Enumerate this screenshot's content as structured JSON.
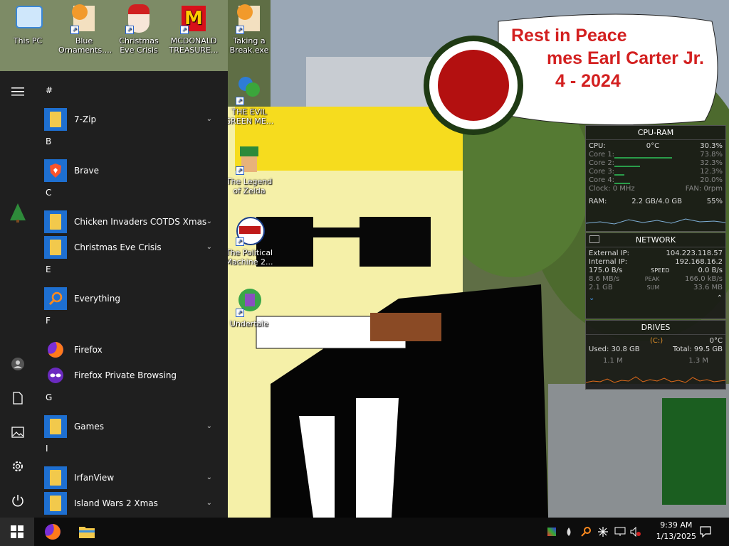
{
  "desktop_icons": [
    {
      "label": "This PC",
      "icon": "computer-icon"
    },
    {
      "label": "Blue Ornaments....",
      "icon": "ornament-app-icon"
    },
    {
      "label": "Christmas Eve Crisis",
      "icon": "santa-app-icon"
    },
    {
      "label": "MCDONALD TREASURE...",
      "icon": "mcdonalds-app-icon"
    },
    {
      "label": "Taking a Break.exe",
      "icon": "break-app-icon"
    },
    {
      "label": "THE EVIL GREEN ME...",
      "icon": "messenger-app-icon"
    },
    {
      "label": "The Legend of Zelda",
      "icon": "zelda-app-icon"
    },
    {
      "label": "The Political Machine 2...",
      "icon": "political-app-icon"
    },
    {
      "label": "Undertale",
      "icon": "undertale-app-icon"
    }
  ],
  "memorial": {
    "line1": "Rest in Peace",
    "line2": "mes Earl Carter Jr.",
    "line3": "4 - 2024"
  },
  "start_menu": {
    "groups": [
      {
        "letter": "#",
        "apps": [
          {
            "name": "7-Zip",
            "folder": true
          }
        ]
      },
      {
        "letter": "B",
        "apps": [
          {
            "name": "Brave",
            "folder": false,
            "icon": "brave-icon"
          }
        ]
      },
      {
        "letter": "C",
        "apps": [
          {
            "name": "Chicken Invaders COTDS Xmas",
            "folder": true
          },
          {
            "name": "Christmas Eve Crisis",
            "folder": true
          }
        ]
      },
      {
        "letter": "E",
        "apps": [
          {
            "name": "Everything",
            "folder": false,
            "icon": "everything-search-icon"
          }
        ]
      },
      {
        "letter": "F",
        "apps": [
          {
            "name": "Firefox",
            "folder": false,
            "icon": "firefox-icon"
          },
          {
            "name": "Firefox Private Browsing",
            "folder": false,
            "icon": "firefox-private-icon"
          }
        ]
      },
      {
        "letter": "G",
        "apps": [
          {
            "name": "Games",
            "folder": true
          }
        ]
      },
      {
        "letter": "I",
        "apps": [
          {
            "name": "IrfanView",
            "folder": true
          },
          {
            "name": "Island Wars 2 Xmas",
            "folder": true
          }
        ]
      }
    ]
  },
  "cpu_ram": {
    "title": "CPU-RAM",
    "cpu_label": "CPU:",
    "cpu_temp": "0°C",
    "cpu_pct": "30.3%",
    "cores": [
      {
        "label": "Core 1:",
        "pct": "73.8%",
        "frac": 0.738
      },
      {
        "label": "Core 2:",
        "pct": "32.3%",
        "frac": 0.323
      },
      {
        "label": "Core 3:",
        "pct": "12.3%",
        "frac": 0.123
      },
      {
        "label": "Core 4:",
        "pct": "20.0%",
        "frac": 0.2
      }
    ],
    "clock": "Clock: 0 MHz",
    "fan": "FAN: 0rpm",
    "ram_label": "RAM:",
    "ram_val": "2.2 GB/4.0 GB",
    "ram_pct": "55%"
  },
  "network": {
    "title": "NETWORK",
    "ext_label": "External IP:",
    "ext_ip": "104.223.118.57",
    "int_label": "Internal IP:",
    "int_ip": "192.168.16.2",
    "speed_up": "175.0 B/s",
    "speed_label": "SPEED",
    "speed_down": "0.0 B/s",
    "peak_up": "8.6 MB/s",
    "peak_label": "PEAK",
    "peak_down": "166.0 kB/s",
    "sum_up": "2.1 GB",
    "sum_label": "SUM",
    "sum_down": "33.6 MB"
  },
  "drives": {
    "title": "DRIVES",
    "drive": "(C:)",
    "temp": "0°C",
    "used": "Used: 30.8 GB",
    "total": "Total: 99.5 GB",
    "read": "1.1 M",
    "write": "1.3 M"
  },
  "taskbar": {
    "time": "9:39 AM",
    "date": "1/13/2025"
  },
  "colors": {
    "start_bg": "#1f1f1f",
    "taskbar_bg": "#0d0d0d",
    "folder_blue": "#1e6fd0",
    "memorial_red": "#d32020"
  }
}
